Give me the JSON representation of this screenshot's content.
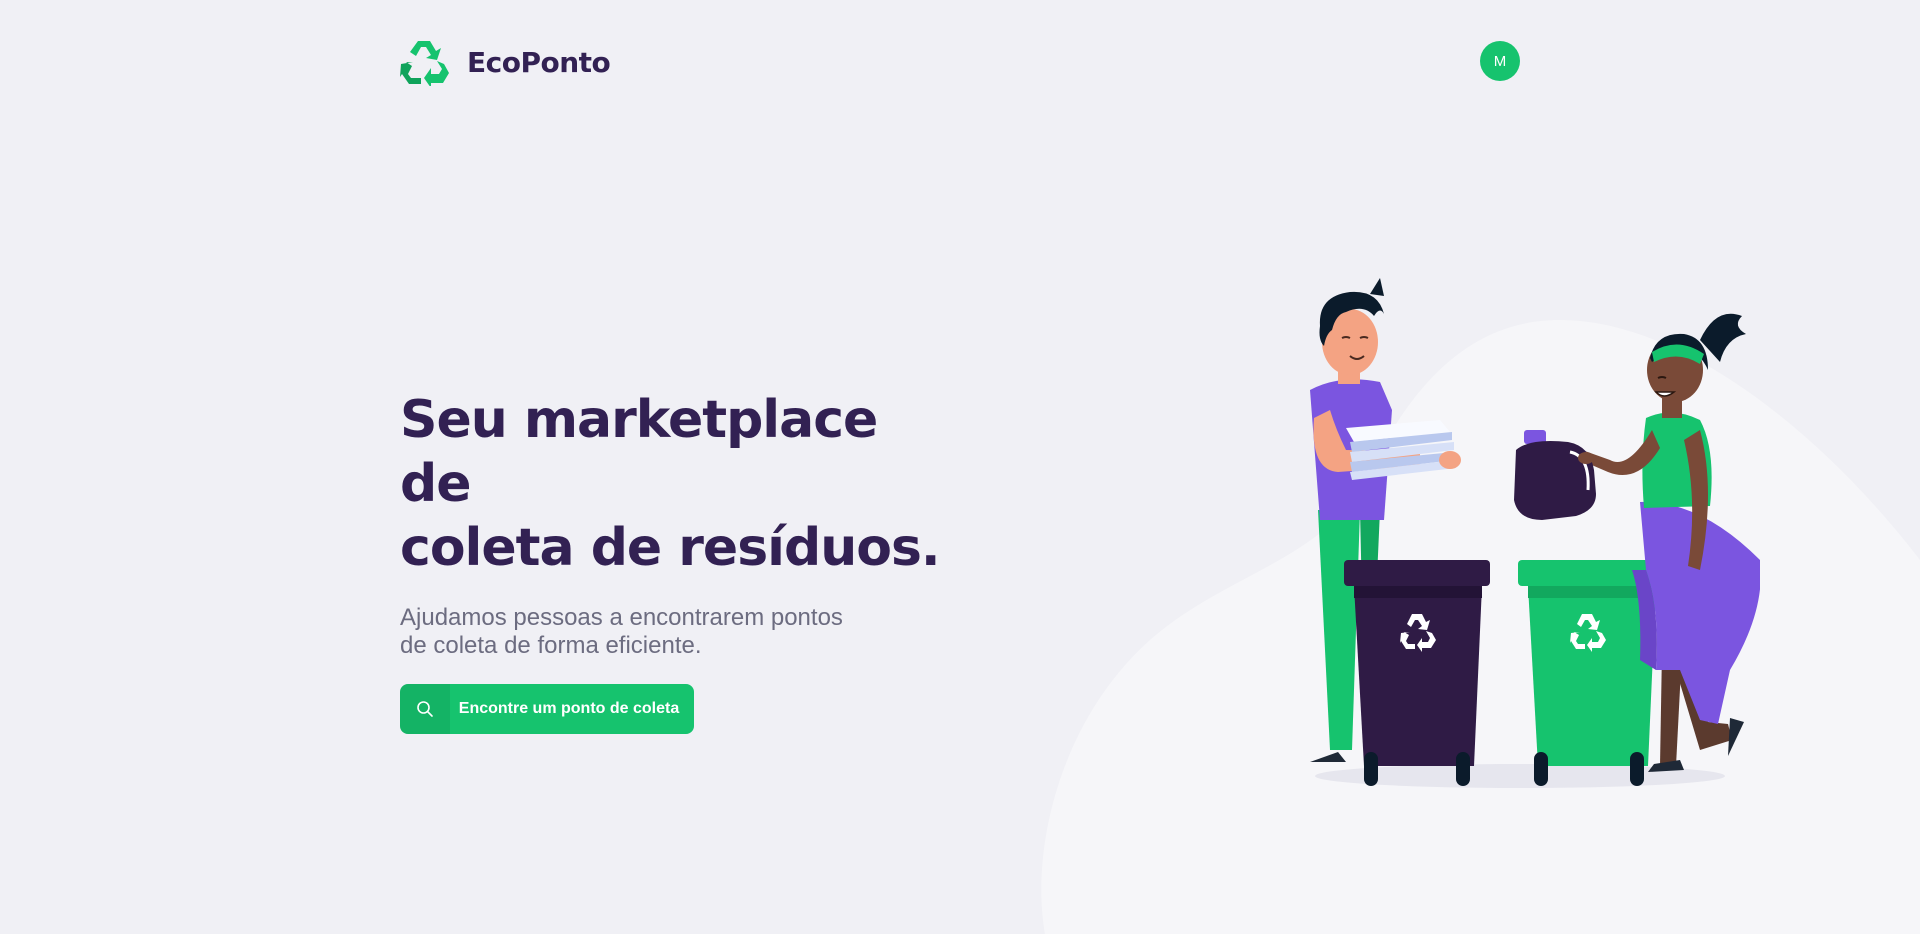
{
  "app": {
    "name": "EcoPonto"
  },
  "header": {
    "avatar_initial": "M"
  },
  "hero": {
    "title_line1": "Seu marketplace de",
    "title_line2": "coleta de resíduos.",
    "subtitle_line1": "Ajudamos pessoas a encontrarem pontos",
    "subtitle_line2": "de coleta de forma eficiente.",
    "cta_label": "Encontre um ponto de coleta"
  },
  "icons": {
    "logo": "recycle-icon",
    "cta": "search-icon",
    "bin": "recycle-icon"
  },
  "colors": {
    "background": "#F0F0F5",
    "primary": "#16C36E",
    "title": "#322153",
    "text": "#6C6C80",
    "accent_purple": "#7B55E0",
    "dark_bin": "#2F1B45"
  }
}
